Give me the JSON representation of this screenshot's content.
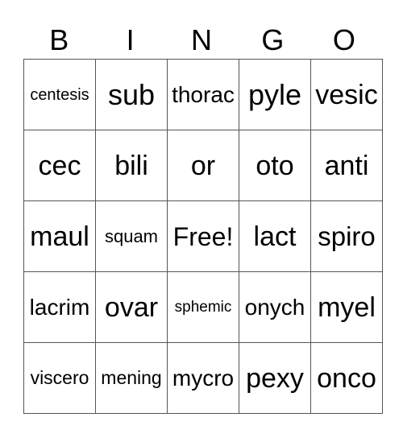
{
  "header": [
    "B",
    "I",
    "N",
    "G",
    "O"
  ],
  "grid": [
    [
      {
        "text": "centesis",
        "size": 20
      },
      {
        "text": "sub",
        "size": 36
      },
      {
        "text": "thorac",
        "size": 28
      },
      {
        "text": "pyle",
        "size": 36
      },
      {
        "text": "vesic",
        "size": 34
      }
    ],
    [
      {
        "text": "cec",
        "size": 34
      },
      {
        "text": "bili",
        "size": 34
      },
      {
        "text": "or",
        "size": 34
      },
      {
        "text": "oto",
        "size": 34
      },
      {
        "text": "anti",
        "size": 34
      }
    ],
    [
      {
        "text": "maul",
        "size": 34
      },
      {
        "text": "squam",
        "size": 22
      },
      {
        "text": "Free!",
        "size": 32
      },
      {
        "text": "lact",
        "size": 34
      },
      {
        "text": "spiro",
        "size": 33
      }
    ],
    [
      {
        "text": "lacrim",
        "size": 28
      },
      {
        "text": "ovar",
        "size": 34
      },
      {
        "text": "sphemic",
        "size": 19
      },
      {
        "text": "onych",
        "size": 28
      },
      {
        "text": "myel",
        "size": 34
      }
    ],
    [
      {
        "text": "viscero",
        "size": 23
      },
      {
        "text": "mening",
        "size": 23
      },
      {
        "text": "mycro",
        "size": 28
      },
      {
        "text": "pexy",
        "size": 34
      },
      {
        "text": "onco",
        "size": 34
      }
    ]
  ]
}
